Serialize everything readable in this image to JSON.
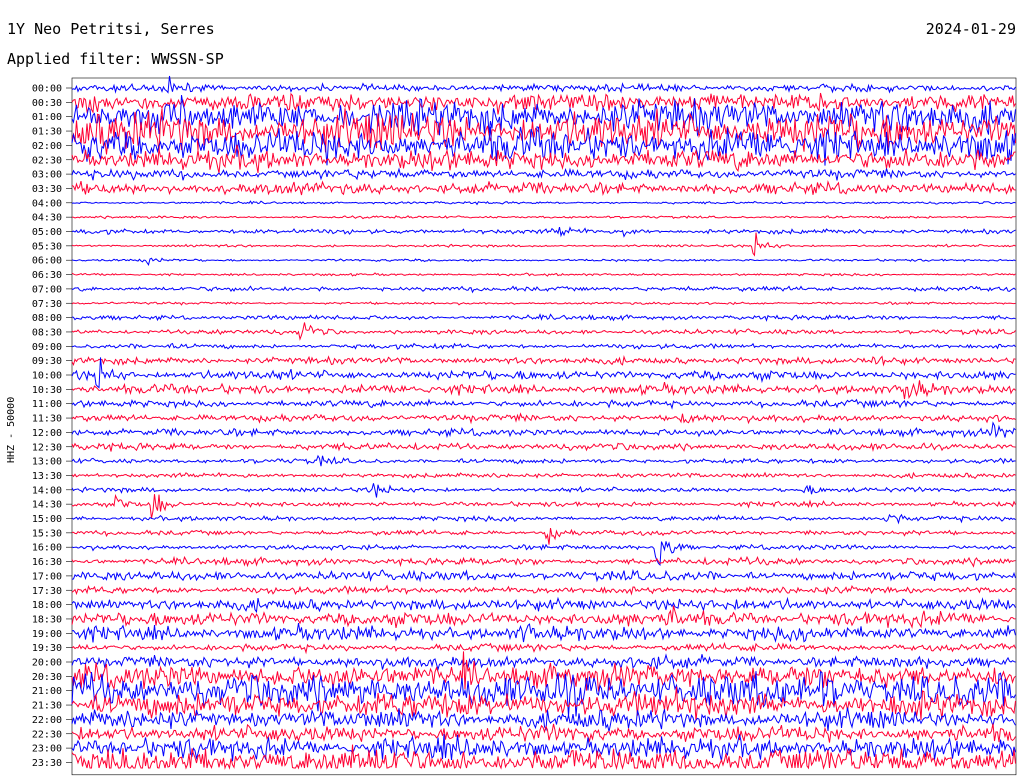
{
  "header": {
    "station": "1Y Neo Petritsi, Serres",
    "date": "2024-01-29",
    "filter": "Applied filter: WWSSN-SP",
    "channel": "HHZ - 50000"
  },
  "colors": {
    "odd": "#0000ff",
    "even": "#ff0033",
    "background": "#ffffff"
  },
  "chart_data": {
    "type": "line",
    "title": "1Y Neo Petritsi, Serres",
    "ylabel": "HHZ - 50000",
    "xlabel": "",
    "categories": [
      "00:00",
      "00:30",
      "01:00",
      "01:30",
      "02:00",
      "02:30",
      "03:00",
      "03:30",
      "04:00",
      "04:30",
      "05:00",
      "05:30",
      "06:00",
      "06:30",
      "07:00",
      "07:30",
      "08:00",
      "08:30",
      "09:00",
      "09:30",
      "10:00",
      "10:30",
      "11:00",
      "11:30",
      "12:00",
      "12:30",
      "13:00",
      "13:30",
      "14:00",
      "14:30",
      "15:00",
      "15:30",
      "16:00",
      "16:30",
      "17:00",
      "17:30",
      "18:00",
      "18:30",
      "19:00",
      "19:30",
      "20:00",
      "20:30",
      "21:00",
      "21:30",
      "22:00",
      "22:30",
      "23:00",
      "23:30"
    ],
    "noise_levels": [
      3,
      8,
      14,
      16,
      14,
      9,
      4,
      5,
      1,
      1,
      2,
      1,
      1,
      1,
      2,
      1,
      2,
      2,
      2,
      3,
      4,
      4,
      3,
      3,
      3,
      3,
      2,
      2,
      2,
      2,
      2,
      2,
      2,
      3,
      4,
      3,
      5,
      6,
      6,
      3,
      5,
      10,
      14,
      11,
      8,
      7,
      9,
      12
    ],
    "events": [
      {
        "row": 0,
        "minute": 3.1,
        "amp": 12
      },
      {
        "row": 10,
        "minute": 15.5,
        "amp": 7
      },
      {
        "row": 10,
        "minute": 17.6,
        "amp": 6
      },
      {
        "row": 11,
        "minute": 21.7,
        "amp": 16
      },
      {
        "row": 12,
        "minute": 2.3,
        "amp": 5
      },
      {
        "row": 17,
        "minute": 7.3,
        "amp": 18
      },
      {
        "row": 19,
        "minute": 25.4,
        "amp": 8
      },
      {
        "row": 20,
        "minute": 0.8,
        "amp": 22
      },
      {
        "row": 21,
        "minute": 26.5,
        "amp": 22
      },
      {
        "row": 23,
        "minute": 19.4,
        "amp": 8
      },
      {
        "row": 24,
        "minute": 29.3,
        "amp": 10
      },
      {
        "row": 26,
        "minute": 7.8,
        "amp": 6
      },
      {
        "row": 28,
        "minute": 9.6,
        "amp": 8
      },
      {
        "row": 28,
        "minute": 23.3,
        "amp": 6
      },
      {
        "row": 29,
        "minute": 1.4,
        "amp": 10
      },
      {
        "row": 29,
        "minute": 2.5,
        "amp": 26
      },
      {
        "row": 30,
        "minute": 25.9,
        "amp": 9
      },
      {
        "row": 31,
        "minute": 15.1,
        "amp": 12
      },
      {
        "row": 32,
        "minute": 18.6,
        "amp": 40
      },
      {
        "row": 37,
        "minute": 19.0,
        "amp": 10
      },
      {
        "row": 38,
        "minute": 14.3,
        "amp": 12
      },
      {
        "row": 41,
        "minute": 12.4,
        "amp": 18
      },
      {
        "row": 42,
        "minute": 15.8,
        "amp": 14
      },
      {
        "row": 42,
        "minute": 23.8,
        "amp": 14
      },
      {
        "row": 47,
        "minute": 3.6,
        "amp": 16
      }
    ]
  }
}
